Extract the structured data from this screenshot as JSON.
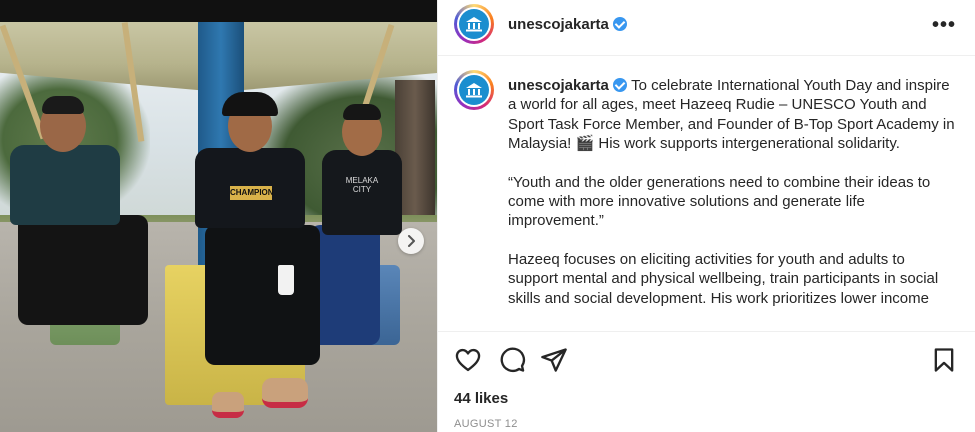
{
  "post": {
    "username": "unescojakarta",
    "more_label": "•••",
    "photo": {
      "shirt_text_champion": "CHAMPION",
      "shirt_text_melaka": "MELAKA CITY"
    },
    "caption": {
      "username": "unescojakarta",
      "paragraph_1": "To celebrate International Youth Day and inspire a world for all ages, meet Hazeeq Rudie – UNESCO Youth and Sport Task Force Member, and Founder of B-Top Sport Academy in Malaysia! 🎬 His work supports intergenerational solidarity.",
      "paragraph_2": "“Youth and the older generations need to combine their ideas to come with more innovative solutions and generate life improvement.”",
      "paragraph_3": "Hazeeq focuses on eliciting activities for youth and adults to support mental and physical wellbeing, train participants in social skills and social development. His work prioritizes lower income"
    },
    "likes_label": "44 likes",
    "date_label": "AUGUST 12"
  },
  "icons": {
    "like": "heart-icon",
    "comment": "comment-icon",
    "share": "share-icon",
    "save": "bookmark-icon",
    "next": "chevron-right-icon"
  },
  "colors": {
    "verified": "#3897f0",
    "text": "#262626",
    "muted": "#8e8e8e"
  }
}
